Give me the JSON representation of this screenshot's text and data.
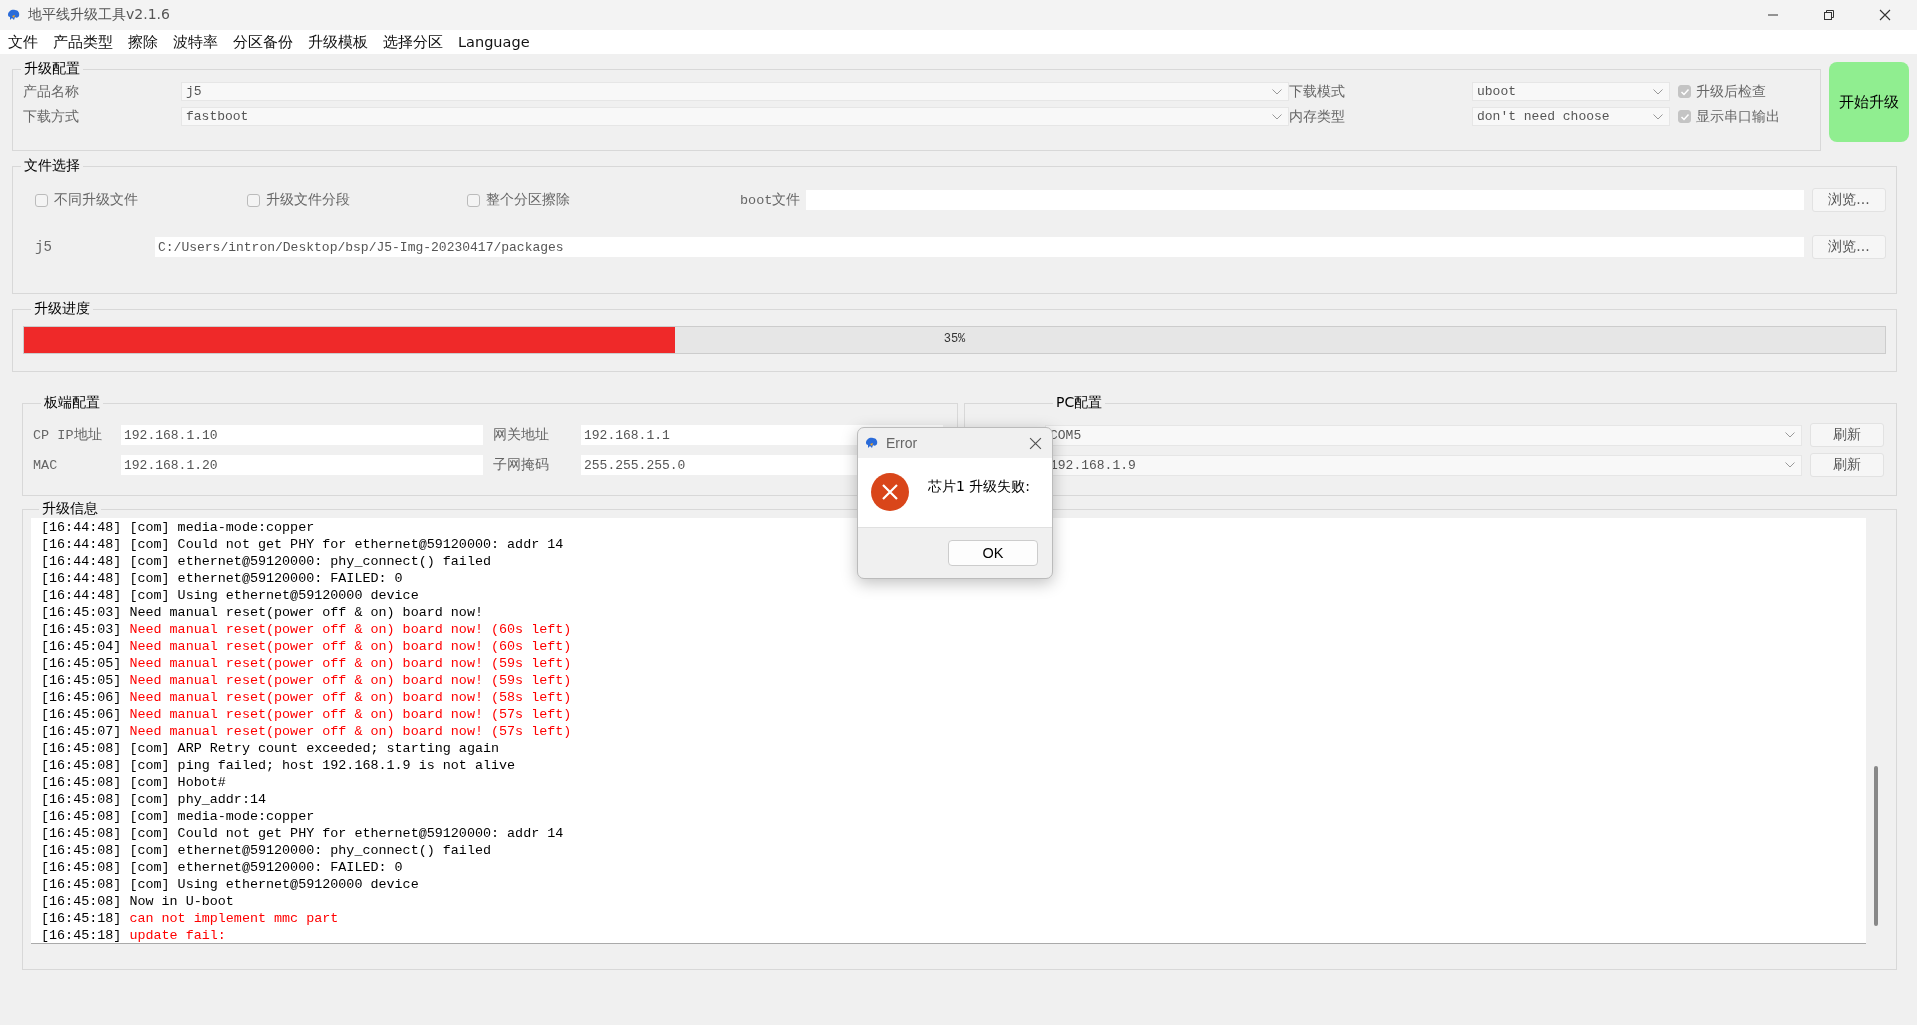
{
  "window": {
    "title": "地平线升级工具v2.1.6"
  },
  "menu": [
    "文件",
    "产品类型",
    "擦除",
    "波特率",
    "分区备份",
    "升级模板",
    "选择分区",
    "Language"
  ],
  "upgrade_config": {
    "title": "升级配置",
    "fields": [
      {
        "label": "产品名称",
        "value": "j5"
      },
      {
        "label": "下载方式",
        "value": "fastboot"
      }
    ],
    "right_fields": [
      {
        "label": "下载模式",
        "value": "uboot",
        "check_label": "升级后检查",
        "checked": true
      },
      {
        "label": "内存类型",
        "value": "don't need choose",
        "check_label": "显示串口输出",
        "checked": true
      }
    ],
    "start_button": "开始升级"
  },
  "file_select": {
    "title": "文件选择",
    "options": [
      {
        "label": "不同升级文件",
        "checked": false
      },
      {
        "label": "升级文件分段",
        "checked": false
      },
      {
        "label": "整个分区擦除",
        "checked": false
      }
    ],
    "boot": {
      "label": "boot文件",
      "browse": "浏览..."
    },
    "path": {
      "label": "j5",
      "value": "C:/Users/intron/Desktop/bsp/J5-Img-20230417/packages",
      "browse": "浏览..."
    }
  },
  "progress": {
    "title": "升级进度",
    "level": 0.35,
    "text": "35%"
  },
  "board_config": {
    "title": "板端配置",
    "rows": [
      {
        "label": "CP IP地址",
        "value": "192.168.1.10",
        "label2": "网关地址",
        "value2": "192.168.1.1"
      },
      {
        "label": "MAC",
        "value": "192.168.1.20",
        "label2": "子网掩码",
        "value2": "255.255.255.0"
      }
    ]
  },
  "pc_config": {
    "title": "PC配置",
    "rows": [
      {
        "value": "COM5",
        "button": "刷新"
      },
      {
        "value": "192.168.1.9",
        "button": "刷新"
      }
    ]
  },
  "log": {
    "title": "升级信息",
    "lines": [
      {
        "time": "[16:44:48]",
        "text": "[com] media-mode:copper",
        "kind": "info"
      },
      {
        "time": "[16:44:48]",
        "text": "[com] Could not get PHY for ethernet@59120000: addr 14",
        "kind": "info"
      },
      {
        "time": "[16:44:48]",
        "text": "[com] ethernet@59120000: phy_connect() failed",
        "kind": "info"
      },
      {
        "time": "[16:44:48]",
        "text": "[com] ethernet@59120000: FAILED: 0",
        "kind": "info"
      },
      {
        "time": "[16:44:48]",
        "text": "[com] Using ethernet@59120000 device",
        "kind": "info"
      },
      {
        "time": "[16:45:03]",
        "text": "Need manual reset(power off & on) board now!",
        "kind": "info"
      },
      {
        "time": "[16:45:03]",
        "text": "Need manual reset(power off & on) board now! (60s left)",
        "kind": "error"
      },
      {
        "time": "[16:45:04]",
        "text": "Need manual reset(power off & on) board now! (60s left)",
        "kind": "error"
      },
      {
        "time": "[16:45:05]",
        "text": "Need manual reset(power off & on) board now! (59s left)",
        "kind": "error"
      },
      {
        "time": "[16:45:05]",
        "text": "Need manual reset(power off & on) board now! (59s left)",
        "kind": "error"
      },
      {
        "time": "[16:45:06]",
        "text": "Need manual reset(power off & on) board now! (58s left)",
        "kind": "error"
      },
      {
        "time": "[16:45:06]",
        "text": "Need manual reset(power off & on) board now! (57s left)",
        "kind": "error"
      },
      {
        "time": "[16:45:07]",
        "text": "Need manual reset(power off & on) board now! (57s left)",
        "kind": "error"
      },
      {
        "time": "[16:45:08]",
        "text": "[com] ARP Retry count exceeded; starting again",
        "kind": "info"
      },
      {
        "time": "[16:45:08]",
        "text": "[com] ping failed; host 192.168.1.9 is not alive",
        "kind": "info"
      },
      {
        "time": "[16:45:08]",
        "text": "[com] Hobot#",
        "kind": "info"
      },
      {
        "time": "[16:45:08]",
        "text": "[com] phy_addr:14",
        "kind": "info"
      },
      {
        "time": "[16:45:08]",
        "text": "[com] media-mode:copper",
        "kind": "info"
      },
      {
        "time": "[16:45:08]",
        "text": "[com] Could not get PHY for ethernet@59120000: addr 14",
        "kind": "info"
      },
      {
        "time": "[16:45:08]",
        "text": "[com] ethernet@59120000: phy_connect() failed",
        "kind": "info"
      },
      {
        "time": "[16:45:08]",
        "text": "[com] ethernet@59120000: FAILED: 0",
        "kind": "info"
      },
      {
        "time": "[16:45:08]",
        "text": "[com] Using ethernet@59120000 device",
        "kind": "info"
      },
      {
        "time": "[16:45:08]",
        "text": "Now in U-boot",
        "kind": "info"
      },
      {
        "time": "[16:45:18]",
        "text": "can not implement mmc part",
        "kind": "error"
      },
      {
        "time": "[16:45:18]",
        "text": "update fail:",
        "kind": "error"
      }
    ]
  },
  "dialog": {
    "title": "Error",
    "message": "芯片1 升级失败:",
    "button": "OK"
  }
}
